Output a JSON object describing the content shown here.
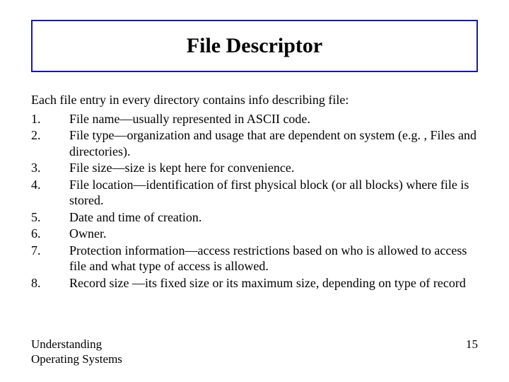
{
  "title": "File Descriptor",
  "intro": "Each file entry in every directory contains info describing file:",
  "items": [
    "File name—usually represented in ASCII code.",
    "File type—organization and usage that are dependent on system (e.g. , Files and directories).",
    "File size—size is kept here for convenience.",
    "File location—identification of first physical block (or all blocks) where file is stored.",
    "Date and time of creation.",
    "Owner.",
    "Protection information—access restrictions based on who is allowed to access file and what type of access is allowed.",
    "Record size —its fixed size or its maximum size, depending on type of record"
  ],
  "footer": {
    "source_line1": "Understanding",
    "source_line2": "Operating Systems",
    "page": "15"
  }
}
